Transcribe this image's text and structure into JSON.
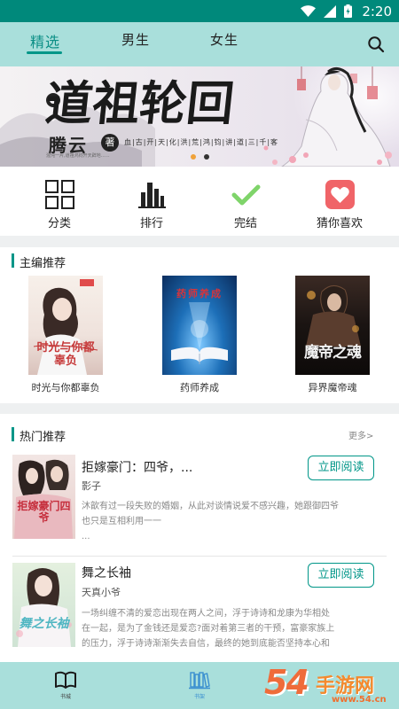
{
  "status_bar": {
    "time": "2:20"
  },
  "nav": {
    "tabs": [
      {
        "label": "精选",
        "active": true
      },
      {
        "label": "男生",
        "active": false
      },
      {
        "label": "女生",
        "active": false
      }
    ]
  },
  "banner": {
    "title": "道祖轮回",
    "author": "腾云",
    "author_suffix": "著",
    "tags": "血|古|开|天|化|洪|荒|鸿|钧|讲|道|三|千|客",
    "description": "混沌一片,道祖鸿钧开天辟地……",
    "active_index": 0,
    "count": 2
  },
  "quick_menu": [
    {
      "label": "分类",
      "icon": "grid-icon"
    },
    {
      "label": "排行",
      "icon": "bar-chart-icon"
    },
    {
      "label": "完结",
      "icon": "checkmark-icon"
    },
    {
      "label": "猜你喜欢",
      "icon": "heart-icon"
    }
  ],
  "editor_picks": {
    "title": "主编推荐",
    "books": [
      {
        "name": "时光与你都辜负",
        "cover_text": "时光与你都辜负"
      },
      {
        "name": "药师养成",
        "cover_text": "药师养成"
      },
      {
        "name": "异界魔帝魂",
        "cover_text": "魔帝之魂"
      }
    ]
  },
  "hot_picks": {
    "title": "热门推荐",
    "more": "更多>",
    "books": [
      {
        "title": "拒嫁豪门：四爷，...",
        "author": "影子",
        "desc_line1": "沐歆有过一段失败的婚姻，从此对谈情说爱不感兴趣，她跟御四爷",
        "desc_line2": "也只是互相利用一一",
        "desc_line3": "...",
        "button": "立即阅读",
        "cover_text": "拒嫁豪门四爷"
      },
      {
        "title": "舞之长袖",
        "author": "天真小爷",
        "desc_line1": "一场纠缠不清的爱恋出现在两人之间，浮于诗诗和龙康为华相处",
        "desc_line2": "在一起，是为了金钱还是爱恋?面对着第三者的干预，富豪家族上",
        "desc_line3": "的压力，浮于诗诗渐渐失去自信，最终的她到底能否坚持本心和",
        "button": "立即阅读",
        "cover_text": "舞之长袖"
      }
    ]
  },
  "bottom_nav": [
    {
      "label": "书城",
      "icon": "open-book-icon"
    },
    {
      "label": "书架",
      "icon": "bookshelf-icon"
    }
  ],
  "watermark": {
    "number": "54",
    "name": "手游网",
    "url": "www.54.cn"
  },
  "colors": {
    "accent": "#009688",
    "nav_bg": "#a9dfdb",
    "status_bg": "#00897b"
  }
}
